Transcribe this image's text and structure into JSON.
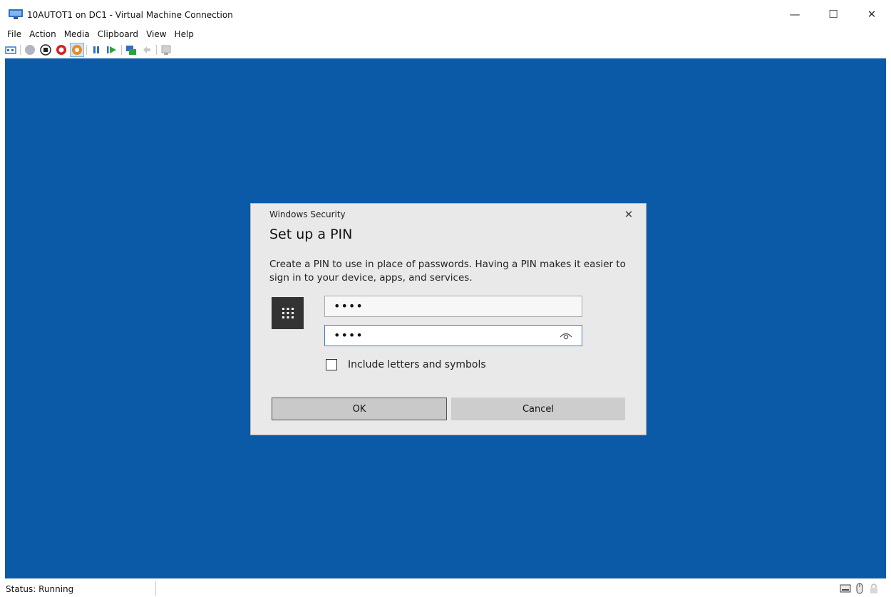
{
  "window": {
    "title": "10AUTOT1 on DC1 - Virtual Machine Connection",
    "minimize_glyph": "—",
    "maximize_glyph": "☐",
    "close_glyph": "✕"
  },
  "menu": {
    "items": [
      "File",
      "Action",
      "Media",
      "Clipboard",
      "View",
      "Help"
    ]
  },
  "toolbar": {
    "icons": [
      "ctrl-alt-del-icon",
      "start-icon",
      "turn-off-icon",
      "shut-down-icon",
      "save-icon",
      "pause-icon",
      "reset-icon",
      "checkpoint-icon",
      "revert-icon",
      "enhanced-session-icon"
    ]
  },
  "dialog": {
    "header": "Windows Security",
    "close_glyph": "✕",
    "title": "Set up a PIN",
    "description": "Create a PIN to use in place of passwords. Having a PIN makes it easier to sign in to your device, apps, and services.",
    "pin_value": "••••",
    "confirm_pin_value": "••••",
    "checkbox_label": "Include letters and symbols",
    "checkbox_checked": false,
    "ok_label": "OK",
    "cancel_label": "Cancel"
  },
  "status": {
    "text": "Status: Running"
  },
  "colors": {
    "vm_background": "#0b5aa8",
    "dialog_background": "#e9e9e9",
    "focus_border": "#3a7bd5"
  }
}
